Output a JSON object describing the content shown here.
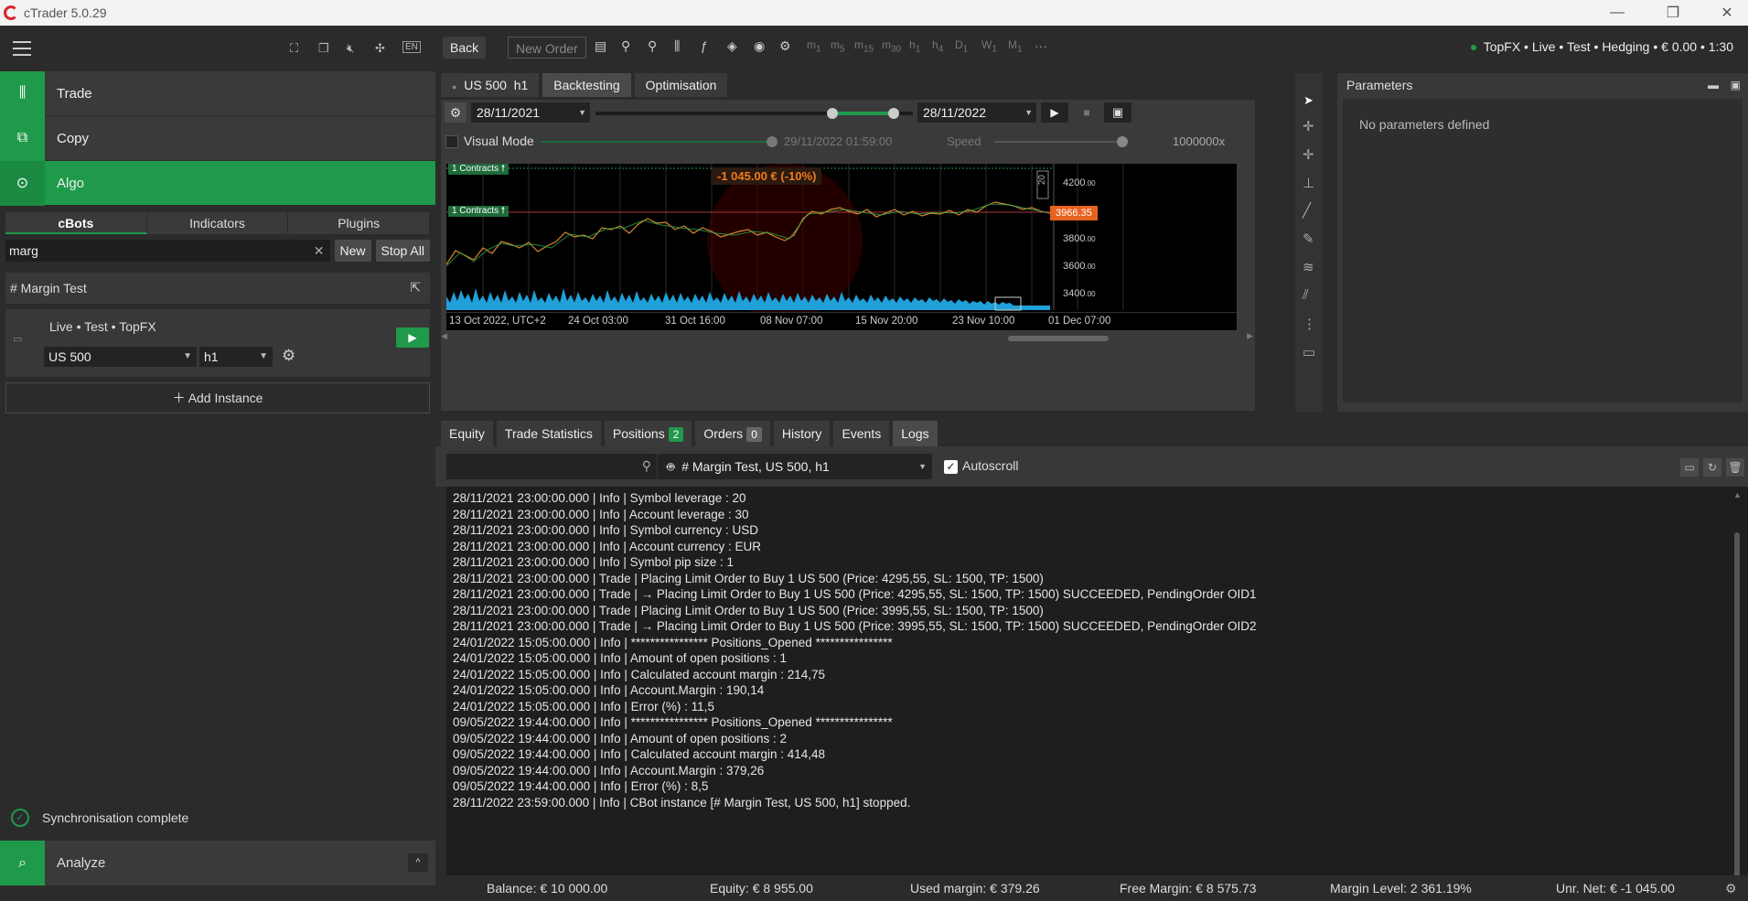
{
  "window": {
    "title": "cTrader 5.0.29"
  },
  "left": {
    "nav": [
      {
        "label": "Trade"
      },
      {
        "label": "Copy"
      },
      {
        "label": "Algo"
      }
    ],
    "tabs": [
      "cBots",
      "Indicators",
      "Plugins"
    ],
    "search_value": "marg",
    "new_label": "New",
    "stop_all_label": "Stop All",
    "cbot_name": "# Margin Test",
    "instance": {
      "account": "Live • Test •  TopFX",
      "symbol": "US 500",
      "timeframe": "h1"
    },
    "add_instance": "Add Instance",
    "sync": "Synchronisation complete",
    "analyze": "Analyze",
    "lang": "EN"
  },
  "toolbar": {
    "back": "Back",
    "new_order": "New Order",
    "timeframes": [
      "m",
      "m",
      "m",
      "m",
      "h",
      "h",
      "D",
      "W",
      "M"
    ],
    "timeframe_subs": [
      "1",
      "5",
      "15",
      "30",
      "1",
      "4",
      "1",
      "1",
      "1"
    ],
    "status": "TopFX • Live • Test • Hedging • € 0.00 • 1:30"
  },
  "chart": {
    "symbol": "US 500",
    "timeframe": "h1",
    "tabs": [
      "Backtesting",
      "Optimisation"
    ],
    "from": "28/11/2021",
    "to": "28/11/2022",
    "visual_mode": "Visual Mode",
    "vm_time": "29/11/2022 01:59:00",
    "speed": "Speed",
    "speed_value": "1000000x",
    "contracts1": "1 Contracts",
    "contracts2": "1 Contracts",
    "pnl": "-1 045.00 € (-10%)",
    "price_tag": "3966.35",
    "y_ticks": [
      {
        "v": "4200",
        "d": ".00"
      },
      {
        "v": "3800",
        "d": ".00"
      },
      {
        "v": "3600",
        "d": ".00"
      },
      {
        "v": "3400",
        "d": ".00"
      }
    ],
    "x_ticks": [
      "13 Oct 2022, UTC+2",
      "24 Oct 03:00",
      "31 Oct 16:00",
      "08 Nov 07:00",
      "15 Nov 20:00",
      "23 Nov 10:00",
      "01 Dec 07:00"
    ],
    "scale_box": "20"
  },
  "params": {
    "title": "Parameters",
    "empty": "No parameters defined"
  },
  "bottom": {
    "tabs": [
      {
        "label": "Equity"
      },
      {
        "label": "Trade Statistics"
      },
      {
        "label": "Positions",
        "badge": "2"
      },
      {
        "label": "Orders",
        "badge": "0"
      },
      {
        "label": "History"
      },
      {
        "label": "Events"
      },
      {
        "label": "Logs"
      }
    ],
    "log_source": "# Margin Test, US 500, h1",
    "autoscroll": "Autoscroll",
    "logs": [
      "28/11/2021 23:00:00.000 | Info | Symbol leverage : 20",
      "28/11/2021 23:00:00.000 | Info | Account leverage : 30",
      "28/11/2021 23:00:00.000 | Info | Symbol currency : USD",
      "28/11/2021 23:00:00.000 | Info | Account currency : EUR",
      "28/11/2021 23:00:00.000 | Info | Symbol pip size : 1",
      "28/11/2021 23:00:00.000 | Trade | Placing Limit Order to Buy 1 US 500 (Price: 4295,55, SL: 1500, TP: 1500)",
      "28/11/2021 23:00:00.000 | Trade | → Placing Limit Order to Buy 1 US 500 (Price: 4295,55, SL: 1500, TP: 1500) SUCCEEDED, PendingOrder OID1",
      "28/11/2021 23:00:00.000 | Trade | Placing Limit Order to Buy 1 US 500 (Price: 3995,55, SL: 1500, TP: 1500)",
      "28/11/2021 23:00:00.000 | Trade | → Placing Limit Order to Buy 1 US 500 (Price: 3995,55, SL: 1500, TP: 1500) SUCCEEDED, PendingOrder OID2",
      "24/01/2022 15:05:00.000 | Info | **************** Positions_Opened ****************",
      "24/01/2022 15:05:00.000 | Info | Amount of open positions : 1",
      "24/01/2022 15:05:00.000 | Info | Calculated account margin : 214,75",
      "24/01/2022 15:05:00.000 | Info | Account.Margin : 190,14",
      "24/01/2022 15:05:00.000 | Info | Error (%) : 11,5",
      "09/05/2022 19:44:00.000 | Info | **************** Positions_Opened ****************",
      "09/05/2022 19:44:00.000 | Info | Amount of open positions : 2",
      "09/05/2022 19:44:00.000 | Info | Calculated account margin : 414,48",
      "09/05/2022 19:44:00.000 | Info | Account.Margin : 379,26",
      "09/05/2022 19:44:00.000 | Info | Error (%) : 8,5",
      "28/11/2022 23:59:00.000 | Info | CBot instance [# Margin Test, US 500, h1] stopped."
    ]
  },
  "footer": {
    "balance": "Balance: € 10 000.00",
    "equity": "Equity: € 8 955.00",
    "used_margin": "Used margin: € 379.26",
    "free_margin": "Free Margin: € 8 575.73",
    "margin_level": "Margin Level: 2 361.19%",
    "unr_net": "Unr. Net: € -1 045.00"
  },
  "colors": {
    "accent": "#1f9a4a",
    "loss": "#f07a1a"
  }
}
